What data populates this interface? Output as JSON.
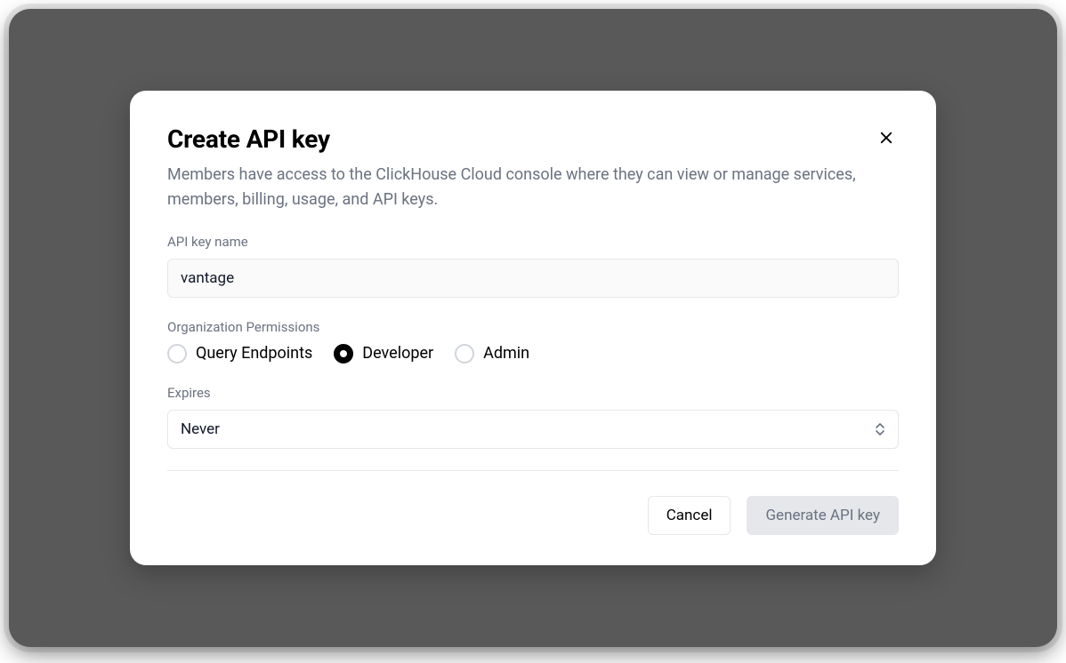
{
  "modal": {
    "title": "Create API key",
    "description": "Members have access to the ClickHouse Cloud console where they can view or manage services, members, billing, usage, and API keys.",
    "fields": {
      "api_key_name": {
        "label": "API key name",
        "value": "vantage"
      },
      "org_permissions": {
        "label": "Organization Permissions",
        "options": [
          {
            "label": "Query Endpoints",
            "selected": false
          },
          {
            "label": "Developer",
            "selected": true
          },
          {
            "label": "Admin",
            "selected": false
          }
        ]
      },
      "expires": {
        "label": "Expires",
        "value": "Never"
      }
    },
    "footer": {
      "cancel_label": "Cancel",
      "generate_label": "Generate API key"
    }
  }
}
